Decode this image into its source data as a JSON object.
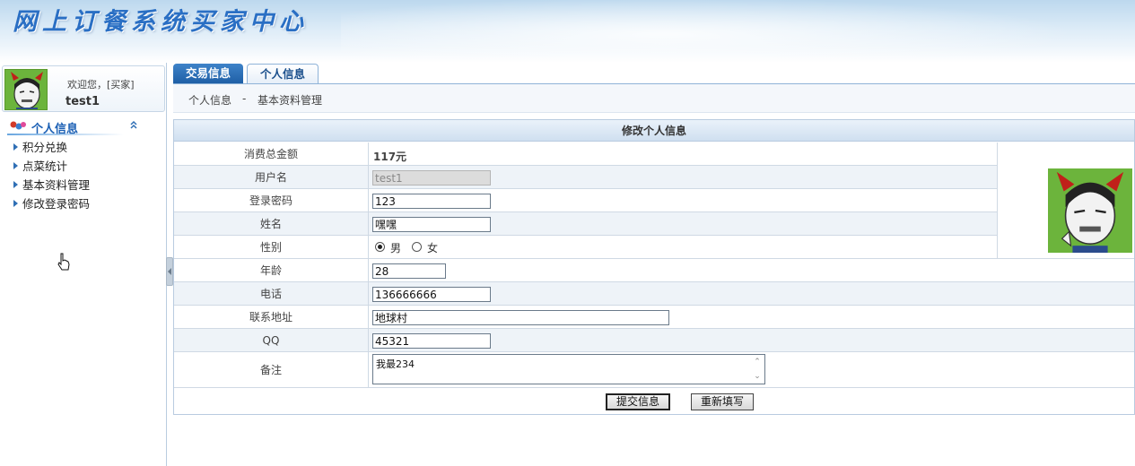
{
  "banner": {
    "title": "网上订餐系统买家中心"
  },
  "user": {
    "welcome": "欢迎您，[买家]",
    "name": "test1"
  },
  "sidebar": {
    "section_title": "个人信息",
    "items": [
      {
        "label": "积分兑换"
      },
      {
        "label": "点菜统计"
      },
      {
        "label": "基本资料管理"
      },
      {
        "label": "修改登录密码"
      }
    ]
  },
  "tabs": [
    {
      "label": "交易信息"
    },
    {
      "label": "个人信息"
    }
  ],
  "breadcrumb": {
    "part1": "个人信息",
    "sep": "-",
    "part2": "基本资料管理"
  },
  "form": {
    "title": "修改个人信息",
    "fields": {
      "total_spent": {
        "label": "消费总金额",
        "value": "117元"
      },
      "username": {
        "label": "用户名",
        "value": "test1"
      },
      "password": {
        "label": "登录密码",
        "value": "123"
      },
      "name": {
        "label": "姓名",
        "value": "嘿嘿"
      },
      "gender": {
        "label": "性别",
        "options": [
          "男",
          "女"
        ],
        "selected": "男"
      },
      "age": {
        "label": "年龄",
        "value": "28"
      },
      "phone": {
        "label": "电话",
        "value": "136666666"
      },
      "address": {
        "label": "联系地址",
        "value": "地球村"
      },
      "qq": {
        "label": "QQ",
        "value": "45321"
      },
      "remark": {
        "label": "备注",
        "value": "我最234"
      }
    },
    "submit_label": "提交信息",
    "reset_label": "重新填写"
  },
  "icons": {
    "avatar": "devil-avatar-icon",
    "section": "people-icon",
    "collapse": "double-chevron-up-icon",
    "menu_bullet": "triangle-right-icon",
    "cursor": "hand-pointer-icon"
  },
  "colors": {
    "accent": "#1a5fb4",
    "avatar_bg": "#6cb43c"
  }
}
